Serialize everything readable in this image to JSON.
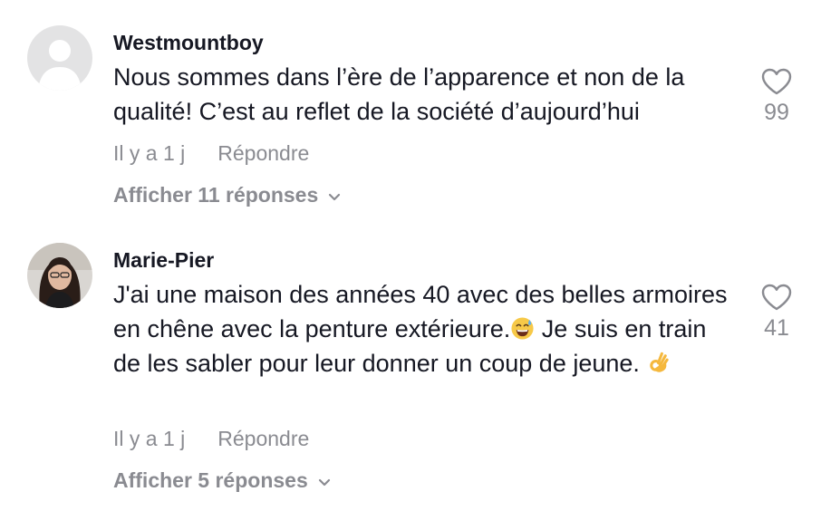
{
  "comments": [
    {
      "username": "Westmountboy",
      "text": "Nous sommes dans l’ère de l’apparence et non de la qualité! C’est au reflet de la société d’aujourd’hui",
      "time": "Il y a 1 j",
      "reply_label": "Répondre",
      "view_replies_label": "Afficher 11 réponses",
      "likes": "99",
      "liked": false,
      "avatar": "default-avatar-icon"
    },
    {
      "username": "Marie-Pier",
      "text_part1": "J'ai une maison des années 40 avec des belles armoires en chêne avec la penture extérieure.",
      "emoji1": "sweat-smile-emoji",
      "text_part2": " Je suis en train de les sabler pour leur donner un coup de jeune. ",
      "emoji2": "ok-hand-emoji",
      "time": "Il y a 1 j",
      "reply_label": "Répondre",
      "view_replies_label": "Afficher 5 réponses",
      "likes": "41",
      "liked": false,
      "avatar": "user-photo"
    }
  ],
  "colors": {
    "text": "#161823",
    "secondary": "#8a8b91",
    "avatar_bg": "#e3e3e4"
  }
}
